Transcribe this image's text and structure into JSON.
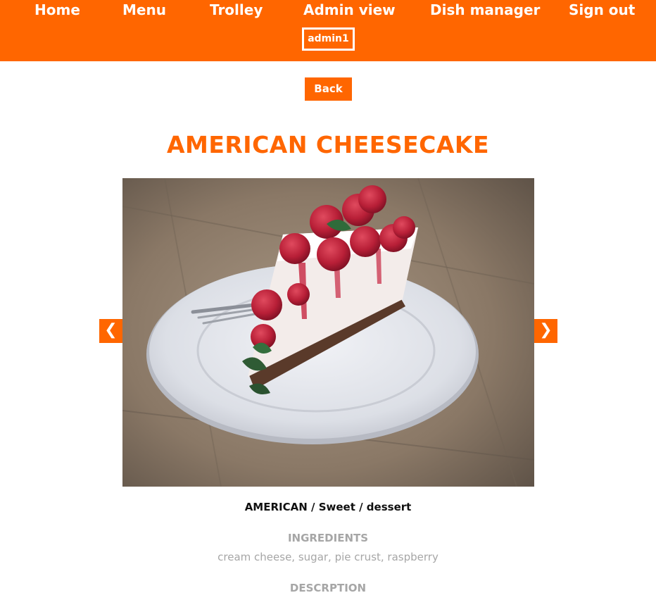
{
  "nav": {
    "home": "Home",
    "menu": "Menu",
    "trolley": "Trolley",
    "admin_view": "Admin view",
    "dish_manager": "Dish manager",
    "sign_out": "Sign out",
    "username": "admin1"
  },
  "page": {
    "back_label": "Back",
    "dish_title": "AMERICAN CHEESECAKE",
    "category_line": "AMERICAN / Sweet / dessert",
    "ingredients_heading": "INGREDIENTS",
    "ingredients_text": "cream cheese, sugar, pie crust, raspberry",
    "description_heading": "DESCRPTION"
  },
  "carousel": {
    "prev_icon": "chevron-left-icon",
    "next_icon": "chevron-right-icon",
    "prev_glyph": "❮",
    "next_glyph": "❯"
  },
  "colors": {
    "brand": "#ff6600",
    "muted": "#a6a6a6",
    "text": "#111111"
  }
}
